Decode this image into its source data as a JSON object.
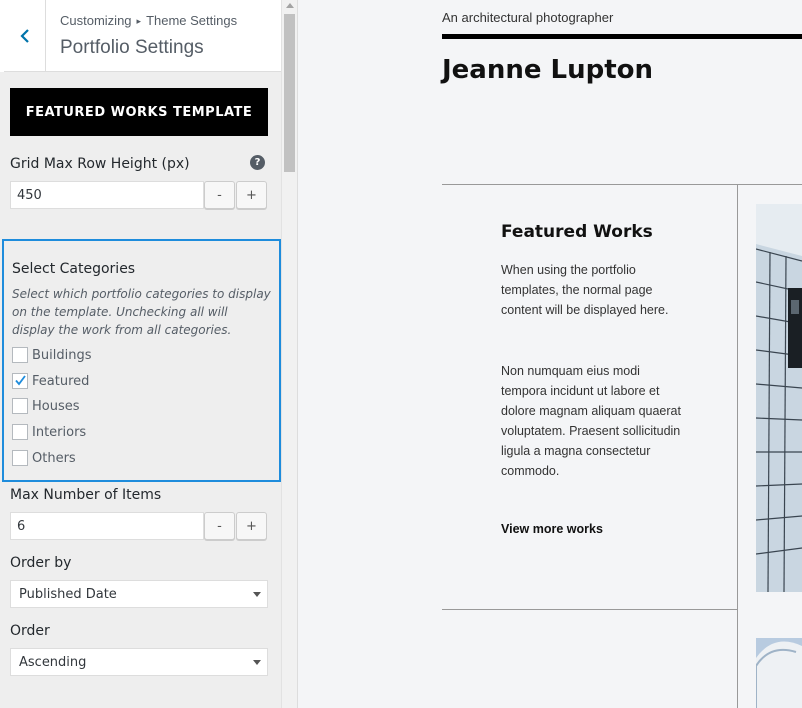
{
  "header": {
    "breadcrumb_root": "Customizing",
    "breadcrumb_separator": "▸",
    "breadcrumb_parent": "Theme Settings",
    "title": "Portfolio Settings",
    "back_icon": "chevron-left-icon"
  },
  "template_button": {
    "label": "FEATURED WORKS TEMPLATE"
  },
  "grid_row_height": {
    "label": "Grid Max Row Height (px)",
    "help_icon": "?",
    "value": "450",
    "decrement": "-",
    "increment": "+"
  },
  "categories": {
    "title": "Select Categories",
    "description": "Select which portfolio categories to display on the template. Unchecking all will display the work from all categories.",
    "items": [
      {
        "label": "Buildings",
        "checked": false
      },
      {
        "label": "Featured",
        "checked": true
      },
      {
        "label": "Houses",
        "checked": false
      },
      {
        "label": "Interiors",
        "checked": false
      },
      {
        "label": "Others",
        "checked": false
      }
    ]
  },
  "max_items": {
    "label": "Max Number of Items",
    "value": "6",
    "decrement": "-",
    "increment": "+"
  },
  "order_by": {
    "label": "Order by",
    "selected": "Published Date"
  },
  "order": {
    "label": "Order",
    "selected": "Ascending"
  },
  "preview": {
    "tagline": "An architectural photographer",
    "site_title": "Jeanne Lupton",
    "featured_title": "Featured Works",
    "paragraph1": "When using the portfolio templates, the normal page content will be displayed here.",
    "paragraph2": "Non numquam eius modi tempora incidunt ut labore et dolore magnam aliquam quaerat voluptatem. Praesent sollicitudin ligula a magna consectetur commodo.",
    "link": "View more works"
  },
  "colors": {
    "accent": "#1e8cdc",
    "sidebar_bg": "#eeeeee",
    "button_bg": "#000000",
    "preview_bg": "#f4f5f7"
  }
}
